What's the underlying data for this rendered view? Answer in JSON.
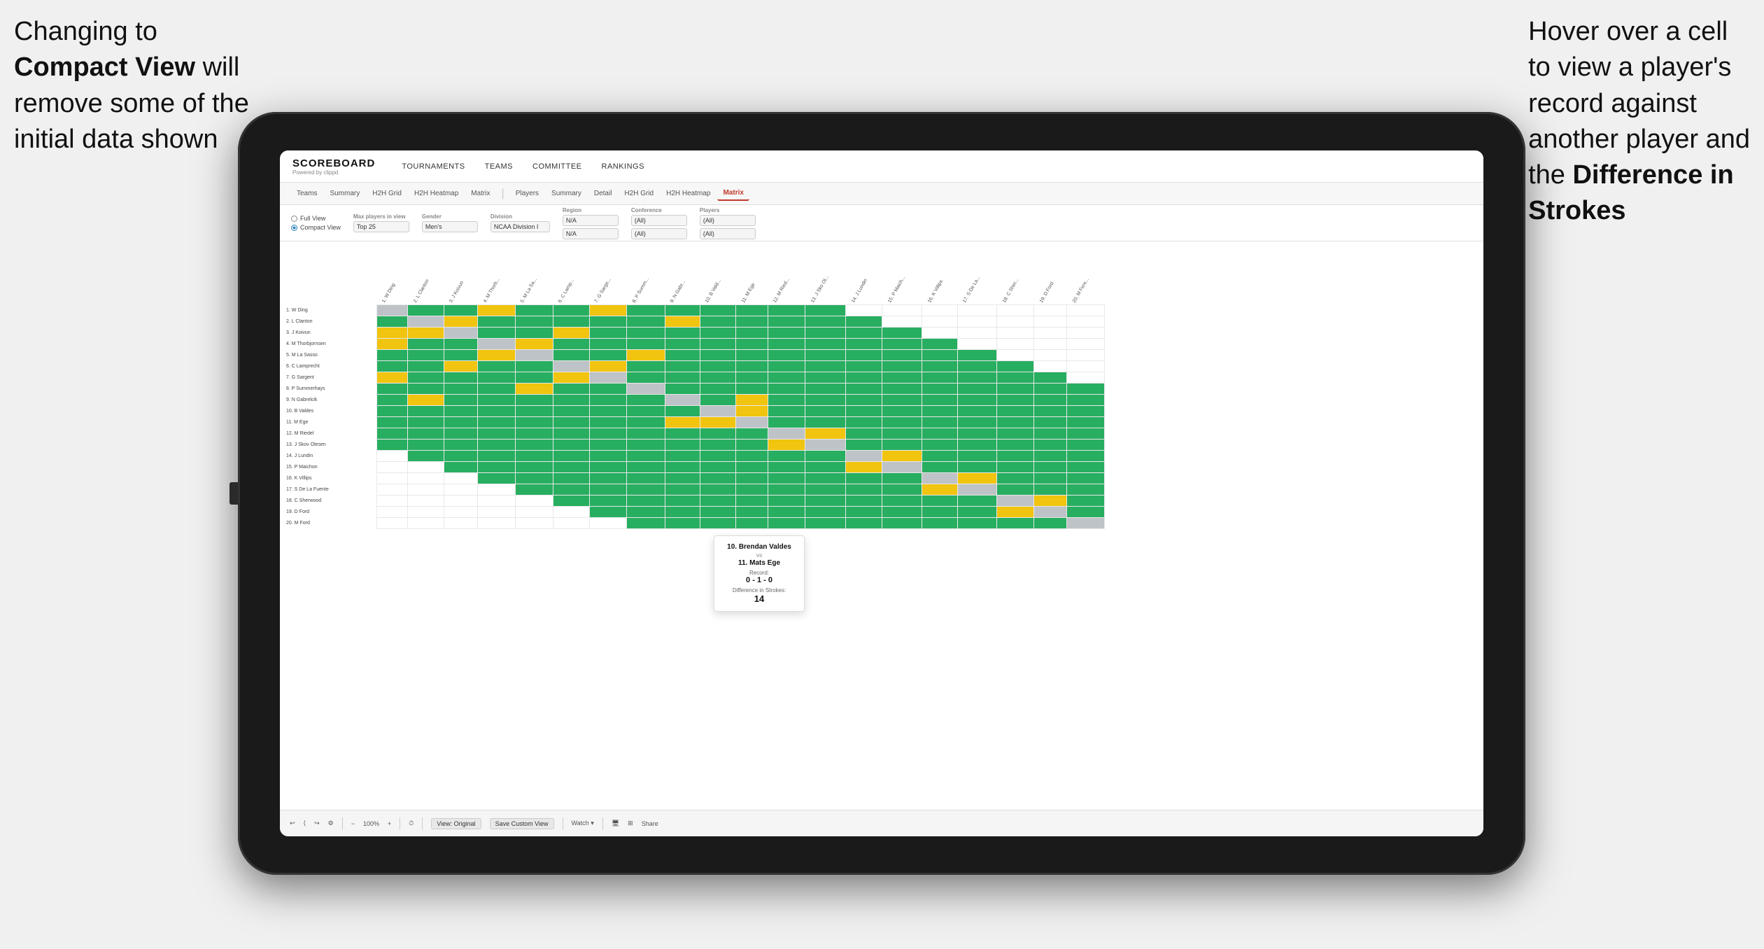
{
  "annotation_left": {
    "line1": "Changing to",
    "bold_part": "Compact View",
    "line2": " will",
    "line3": "remove some of the",
    "line4": "initial data shown"
  },
  "annotation_right": {
    "line1": "Hover over a cell",
    "line2": "to view a player's",
    "line3": "record against",
    "line4": "another player and",
    "line5": "the ",
    "bold_part": "Difference in",
    "line6": "Strokes"
  },
  "app": {
    "logo": "SCOREBOARD",
    "logo_sub": "Powered by clippd",
    "nav": [
      "TOURNAMENTS",
      "TEAMS",
      "COMMITTEE",
      "RANKINGS"
    ],
    "tabs": [
      "Teams",
      "Summary",
      "H2H Grid",
      "H2H Heatmap",
      "Matrix",
      "Players",
      "Summary",
      "Detail",
      "H2H Grid",
      "H2H Heatmap",
      "Matrix"
    ],
    "active_tab": "Matrix"
  },
  "filters": {
    "view_options": [
      "Full View",
      "Compact View"
    ],
    "selected_view": "Compact View",
    "max_players_label": "Max players in view",
    "max_players_value": "Top 25",
    "gender_label": "Gender",
    "gender_value": "Men's",
    "division_label": "Division",
    "division_value": "NCAA Division I",
    "region_label": "Region",
    "region_value": "N/A",
    "conference_label": "Conference",
    "conference_value": "(All)",
    "players_label": "Players",
    "players_value": "(All)"
  },
  "players": [
    "1. W Ding",
    "2. L Clanton",
    "3. J Koivun",
    "4. M Thorbjornsen",
    "5. M La Sasso",
    "6. C Lamprecht",
    "7. G Sargent",
    "8. P Summerhays",
    "9. N Gabrelcik",
    "10. B Valdes",
    "11. M Ege",
    "12. M Riedel",
    "13. J Skov Olesen",
    "14. J Lundin",
    "15. P Maichon",
    "16. K Villips",
    "17. S De La Fuente",
    "18. C Sherwood",
    "19. D Ford",
    "20. M Ford"
  ],
  "col_headers": [
    "1. W Ding",
    "2. L Clanton",
    "3. J Koivun",
    "4. M Thorb...",
    "5. M La Sa...",
    "6. C Lamp...",
    "7. G Sarge...",
    "8. P Summ...",
    "9. N Gabr...",
    "10. B Vald...",
    "11. M Ege",
    "12. M Ried...",
    "13. J Sko...",
    "14. J Lund...",
    "15. P Maich...",
    "16. K Villips",
    "17. S De La...",
    "18. C Sher...",
    "19. D Ford",
    "20. M Fere..."
  ],
  "tooltip": {
    "player1": "10. Brendan Valdes",
    "vs": "vs",
    "player2": "11. Mats Ege",
    "record_label": "Record:",
    "record": "0 - 1 - 0",
    "diff_label": "Difference in Strokes:",
    "diff": "14"
  },
  "toolbar": {
    "undo": "↩",
    "redo": "↪",
    "view_original": "View: Original",
    "save_custom": "Save Custom View",
    "watch": "Watch ▾",
    "share": "Share"
  }
}
